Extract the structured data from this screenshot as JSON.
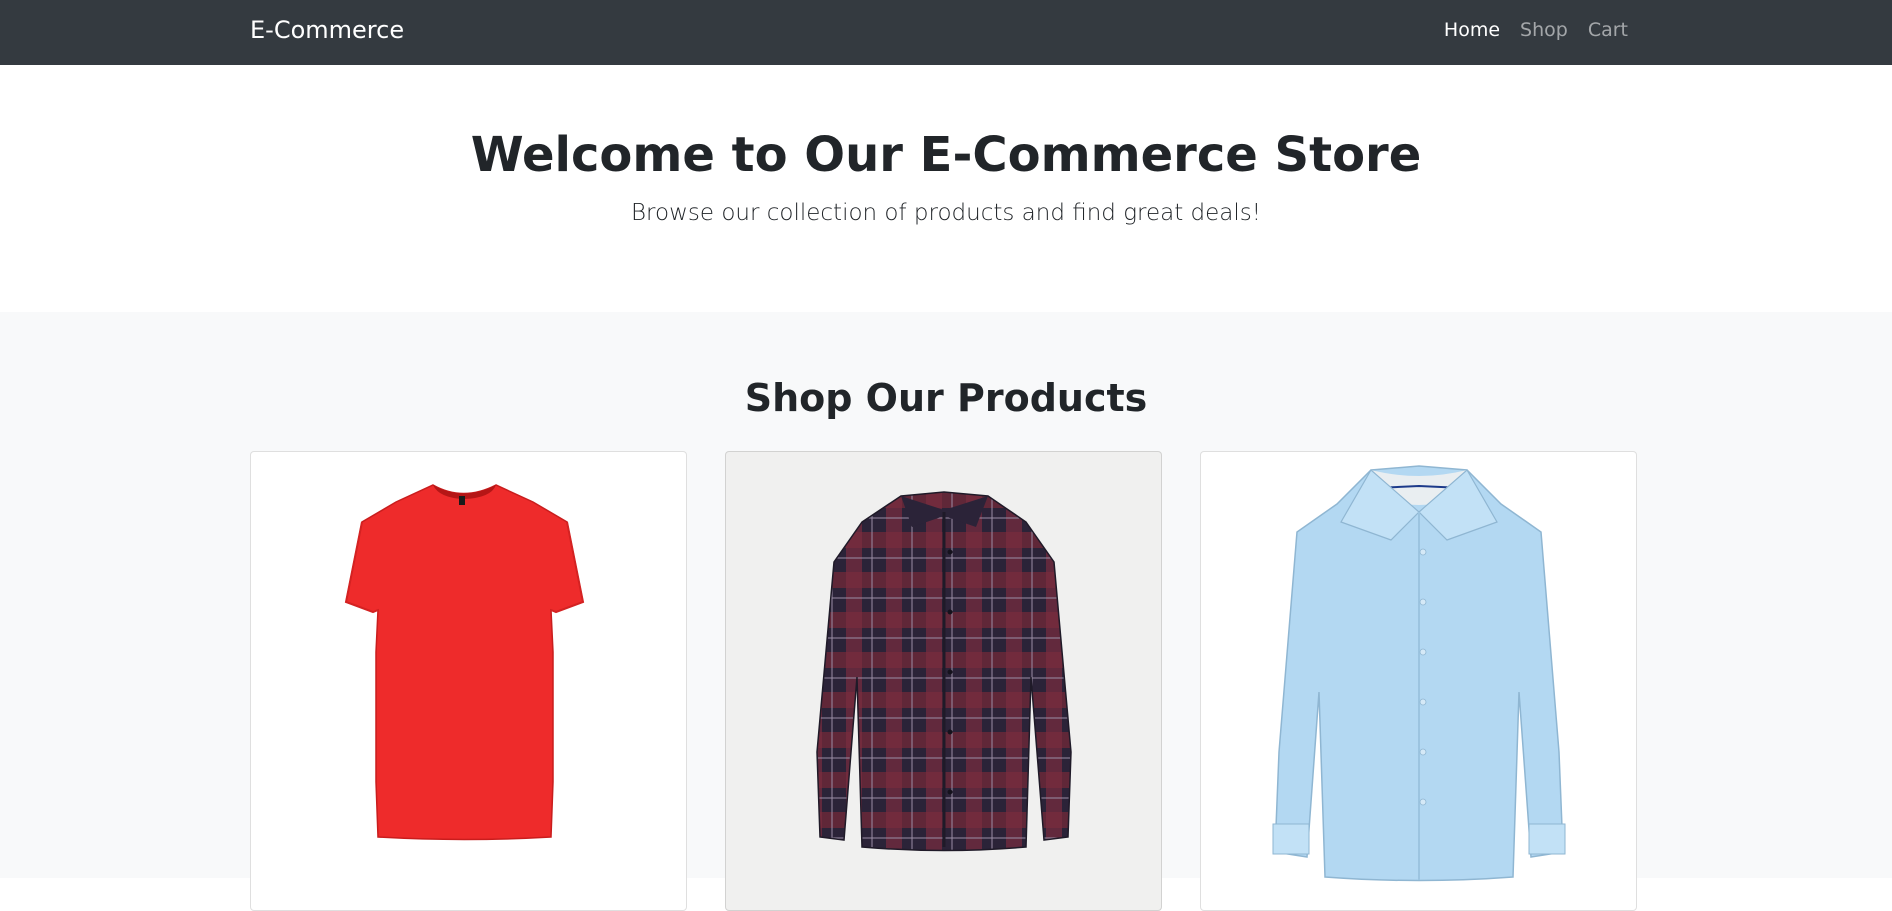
{
  "navbar": {
    "brand": "E-Commerce",
    "links": [
      {
        "label": "Home",
        "active": true
      },
      {
        "label": "Shop",
        "active": false
      },
      {
        "label": "Cart",
        "active": false
      }
    ]
  },
  "hero": {
    "title": "Welcome to Our E-Commerce Store",
    "subtitle": "Browse our collection of products and find great deals!"
  },
  "products": {
    "heading": "Shop Our Products",
    "items": [
      {
        "image": "red-tshirt",
        "color": "#ee2b2b"
      },
      {
        "image": "plaid-flannel-shirt",
        "color": "#4a2030"
      },
      {
        "image": "light-blue-dress-shirt",
        "color": "#b3d8f2"
      }
    ]
  },
  "colors": {
    "navbar_bg": "#343a40",
    "section_bg": "#f8f9fa"
  }
}
